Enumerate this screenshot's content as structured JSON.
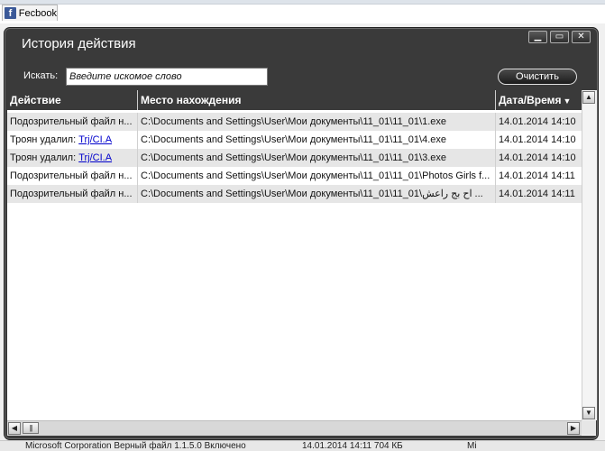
{
  "host": {
    "tab_label": "Fecbook",
    "tab_icon": "facebook-icon",
    "status_left": "Microsoft Corporation Верный файл 1.1.5.0 Включено",
    "status_mid": "14.01.2014 14:11  704 КБ",
    "status_right": "Mi"
  },
  "dialog": {
    "title": "История действия",
    "search": {
      "label": "Искать:",
      "placeholder": "Введите искомое слово",
      "value": ""
    },
    "clear_label": "Очистить",
    "columns": [
      "Действие",
      "Место нахождения",
      "Дата/Время"
    ],
    "rows": [
      {
        "action": "Подозрительный файл н...",
        "action_link": "",
        "path": "C:\\Documents and Settings\\User\\Мои документы\\11_01\\11_01\\1.exe",
        "datetime": "14.01.2014 14:10"
      },
      {
        "action": "Троян удалил: ",
        "action_link": "Trj/CI.A",
        "path": "C:\\Documents and Settings\\User\\Мои документы\\11_01\\11_01\\4.exe",
        "datetime": "14.01.2014 14:10"
      },
      {
        "action": "Троян удалил: ",
        "action_link": "Trj/CI.A",
        "path": "C:\\Documents and Settings\\User\\Мои документы\\11_01\\11_01\\3.exe",
        "datetime": "14.01.2014 14:10"
      },
      {
        "action": "Подозрительный файл н...",
        "action_link": "",
        "path": "C:\\Documents and Settings\\User\\Мои документы\\11_01\\11_01\\Photos Girls f...",
        "datetime": "14.01.2014 14:11"
      },
      {
        "action": "Подозрительный файл н...",
        "action_link": "",
        "path": "C:\\Documents and Settings\\User\\Мои документы\\11_01\\11_01\\اح بج راعش ...",
        "datetime": "14.01.2014 14:11"
      }
    ]
  },
  "colors": {
    "dialog_bg": "#3a3a3a",
    "row_alt": "#e6e6e6",
    "link": "#0000cc"
  }
}
